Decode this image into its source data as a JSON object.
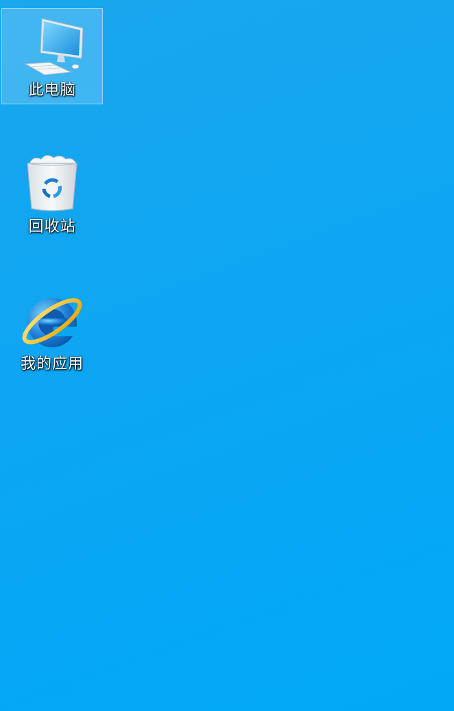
{
  "desktop": {
    "background_color": "#0aa6f3",
    "icons": [
      {
        "label": "此电脑",
        "icon": "computer-icon",
        "selected": true
      },
      {
        "label": "回收站",
        "icon": "recycle-bin-icon",
        "selected": false
      },
      {
        "label": "我的应用",
        "icon": "internet-explorer-icon",
        "selected": false
      }
    ]
  }
}
